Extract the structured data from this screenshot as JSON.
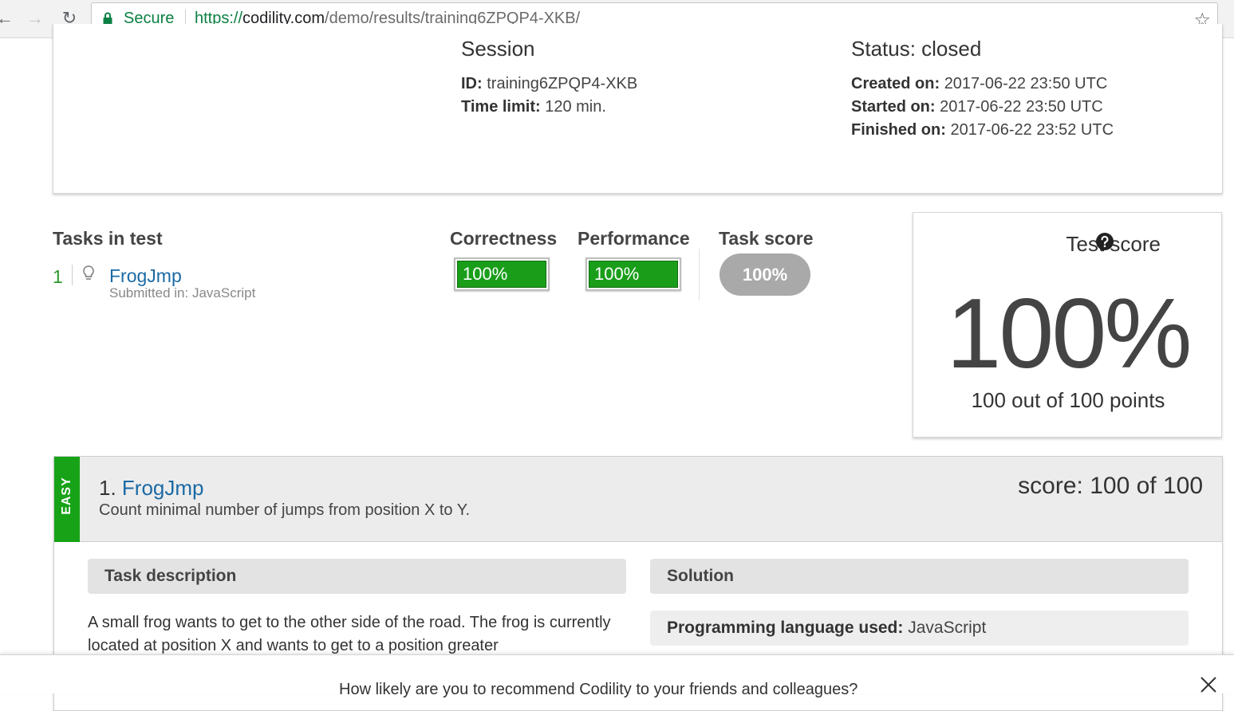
{
  "browser": {
    "secure_label": "Secure",
    "url_scheme": "https://",
    "url_host": "codility.com",
    "url_path": "/demo/results/training6ZPQP4-XKB/"
  },
  "session": {
    "heading": "Session",
    "id_label": "ID:",
    "id_value": "training6ZPQP4-XKB",
    "time_label": "Time limit:",
    "time_value": "120 min."
  },
  "status": {
    "heading": "Status: closed",
    "created_label": "Created on:",
    "created_value": "2017-06-22 23:50 UTC",
    "started_label": "Started on:",
    "started_value": "2017-06-22 23:50 UTC",
    "finished_label": "Finished on:",
    "finished_value": "2017-06-22 23:52 UTC"
  },
  "tasks_table": {
    "headers": {
      "tasks": "Tasks in test",
      "correctness": "Correctness",
      "performance": "Performance",
      "task_score": "Task score"
    },
    "rows": [
      {
        "number": "1",
        "name": "FrogJmp",
        "submitted": "Submitted in: JavaScript",
        "correctness": "100%",
        "performance": "100%",
        "task_score": "100%"
      }
    ]
  },
  "test_score": {
    "title": "Test score",
    "value": "100%",
    "points": "100 out of 100 points"
  },
  "task_detail": {
    "difficulty": "EASY",
    "number_prefix": "1.",
    "name": "FrogJmp",
    "summary": "Count minimal number of jumps from position X to Y.",
    "score": "score: 100 of 100",
    "description_header": "Task description",
    "solution_header": "Solution",
    "description_text": "A small frog wants to get to the other side of the road. The frog is currently located at position X and wants to get to a position greater",
    "language_label": "Programming language used:",
    "language_value": "JavaScript"
  },
  "survey": {
    "question": "How likely are you to recommend Codility to your friends and colleagues?"
  },
  "colors": {
    "accent_green": "#1a9e1a",
    "link_blue": "#1b6aa5",
    "secure_green": "#0b8043"
  }
}
